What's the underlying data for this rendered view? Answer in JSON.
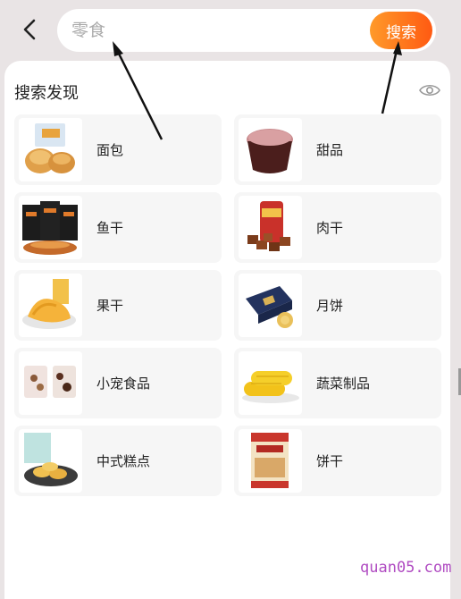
{
  "search": {
    "placeholder": "零食",
    "button_label": "搜索"
  },
  "section": {
    "title": "搜索发现"
  },
  "categories": [
    {
      "label": "面包",
      "icon": "bread-icon"
    },
    {
      "label": "甜品",
      "icon": "dessert-cup-icon"
    },
    {
      "label": "鱼干",
      "icon": "dried-fish-icon"
    },
    {
      "label": "肉干",
      "icon": "jerky-icon"
    },
    {
      "label": "果干",
      "icon": "dried-mango-icon"
    },
    {
      "label": "月饼",
      "icon": "mooncake-icon"
    },
    {
      "label": "小宠食品",
      "icon": "pet-food-icon"
    },
    {
      "label": "蔬菜制品",
      "icon": "corn-icon"
    },
    {
      "label": "中式糕点",
      "icon": "pastry-icon"
    },
    {
      "label": "饼干",
      "icon": "biscuit-box-icon"
    }
  ],
  "watermark": "quan05.com",
  "colors": {
    "accent_start": "#ff9a2a",
    "accent_end": "#ff5a12",
    "background": "#e9e4e5"
  }
}
